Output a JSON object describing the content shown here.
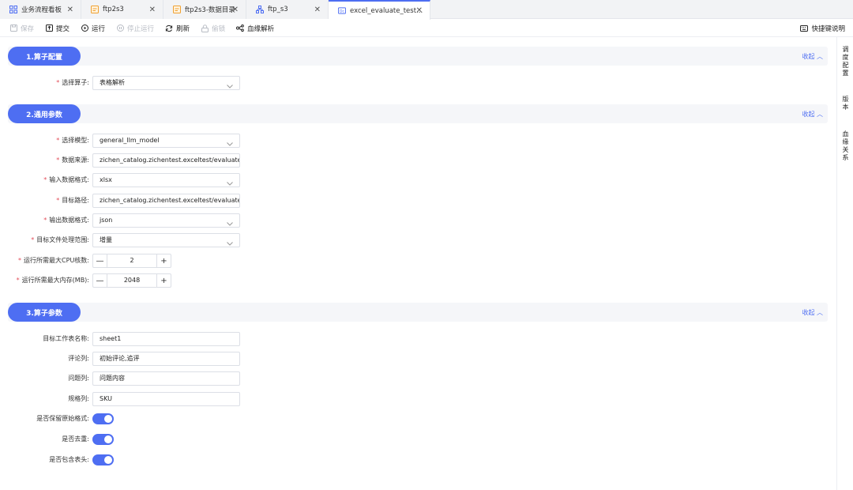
{
  "tabs": [
    {
      "label": "业务流程看板",
      "icon": "grid-icon",
      "active": false
    },
    {
      "label": "ftp2s3",
      "icon": "file-icon",
      "active": false
    },
    {
      "label": "ftp2s3-数据目录",
      "icon": "file-icon",
      "active": false
    },
    {
      "label": "ftp_s3",
      "icon": "flow-icon",
      "active": false
    },
    {
      "label": "excel_evaluate_test...",
      "icon": "doc-icon",
      "active": true
    }
  ],
  "toolbar": {
    "save": "保存",
    "submit": "提交",
    "run": "运行",
    "stop": "停止运行",
    "refresh": "刷新",
    "lock": "偷锁",
    "lineage": "血缘解析",
    "shortcuts": "快捷键说明"
  },
  "sidepanel": {
    "schedule": "调\n度\n配\n置",
    "version": "版\n本",
    "lineage": "血\n缘\n关\n系"
  },
  "sections": {
    "s1": {
      "title": "1.算子配置",
      "collapse": "收起"
    },
    "s2": {
      "title": "2.通用参数",
      "collapse": "收起"
    },
    "s3": {
      "title": "3.算子参数",
      "collapse": "收起"
    }
  },
  "operator": {
    "label": "选择算子:",
    "value": "表格解析"
  },
  "general": {
    "model": {
      "label": "选择模型:",
      "value": "general_llm_model"
    },
    "source": {
      "label": "数据来源:",
      "value": "zichen_catalog.zichentest.exceltest/evaluate"
    },
    "input_format": {
      "label": "输入数据格式:",
      "value": "xlsx"
    },
    "target_path": {
      "label": "目标路径:",
      "value": "zichen_catalog.zichentest.exceltest/evaluate/out"
    },
    "output_format": {
      "label": "输出数据格式:",
      "value": "json"
    },
    "range": {
      "label": "目标文件处理范围:",
      "value": "增量"
    },
    "cpu": {
      "label": "运行所需最大CPU核数:",
      "value": "2"
    },
    "memory": {
      "label": "运行所需最大内存(MB):",
      "value": "2048"
    }
  },
  "params": {
    "sheet": {
      "label": "目标工作表名称:",
      "value": "sheet1"
    },
    "comment": {
      "label": "评论列:",
      "value": "初始评论,追评"
    },
    "question": {
      "label": "问题列:",
      "value": "问题内容"
    },
    "spec": {
      "label": "规格列:",
      "value": "SKU"
    },
    "keep_format": {
      "label": "是否保留原始格式:",
      "on": true
    },
    "dedupe": {
      "label": "是否去重:",
      "on": true
    },
    "header": {
      "label": "是否包含表头:",
      "on": true
    }
  },
  "colors": {
    "accent": "#4e6ef2",
    "required": "#e34d59"
  }
}
